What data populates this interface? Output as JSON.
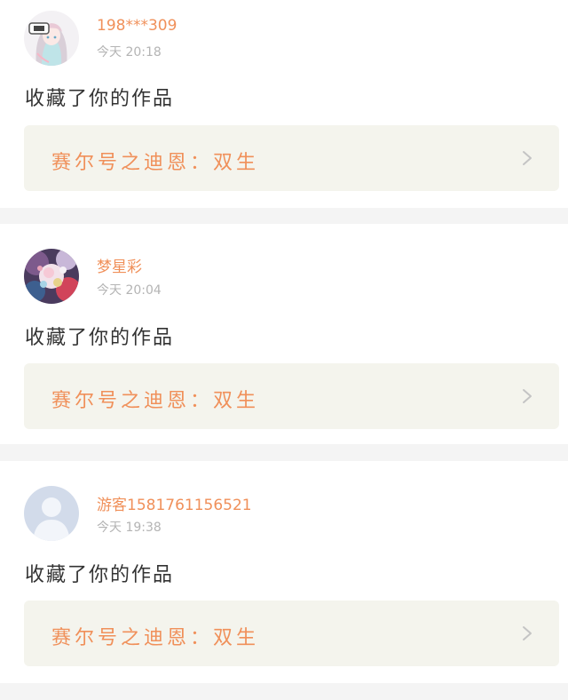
{
  "items": [
    {
      "user_name": "198***309",
      "time": "今天  20:18",
      "action": "收藏了你的作品",
      "work_title": "赛尔号之迪恩：双生",
      "avatar": "anime-girl-avatar"
    },
    {
      "user_name": "梦星彩",
      "time": "今天  20:04",
      "action": "收藏了你的作品",
      "work_title": "赛尔号之迪恩：双生",
      "avatar": "colorful-art-avatar"
    },
    {
      "user_name": "游客1581761156521",
      "time": "今天  19:38",
      "action": "收藏了你的作品",
      "work_title": "赛尔号之迪恩：双生",
      "avatar": "default-user-avatar"
    }
  ],
  "colors": {
    "accent": "#f0905a",
    "time": "#b4b4b4",
    "link_bg": "#f4f4ed",
    "separator": "#f4f4f4"
  }
}
